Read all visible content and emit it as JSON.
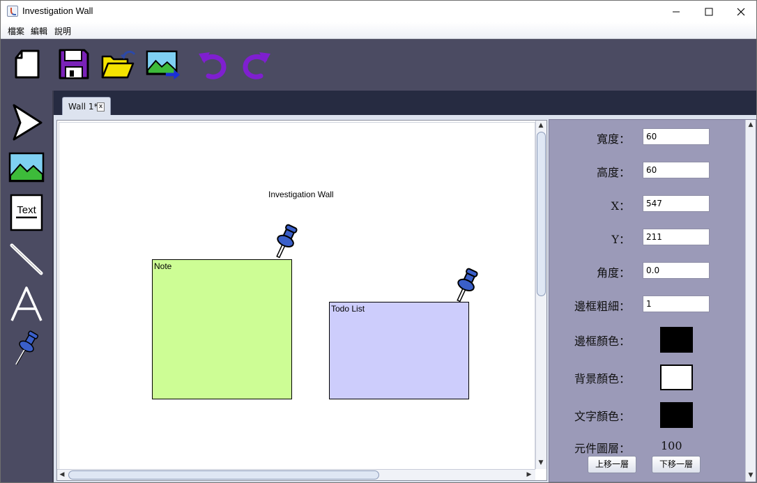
{
  "window": {
    "title": "Investigation Wall",
    "controls": {
      "minimize": "minimize",
      "maximize": "maximize",
      "close": "close"
    }
  },
  "menu": {
    "items": [
      "檔案",
      "編輯",
      "說明"
    ]
  },
  "toolbar": {
    "buttons": [
      {
        "icon": "new-file-icon"
      },
      {
        "icon": "save-icon",
        "color": "#7a22b8"
      },
      {
        "icon": "open-folder-icon",
        "color": "#f5e400"
      },
      {
        "icon": "export-image-icon"
      },
      {
        "icon": "undo-icon",
        "color": "#7f1fd0"
      },
      {
        "icon": "redo-icon",
        "color": "#7f1fd0"
      }
    ]
  },
  "sidebar": {
    "tools": [
      {
        "icon": "select-arrow-icon"
      },
      {
        "icon": "image-tool-icon"
      },
      {
        "icon": "text-tool-icon",
        "label": "Text"
      },
      {
        "icon": "line-tool-icon"
      },
      {
        "icon": "letter-a-tool-icon"
      },
      {
        "icon": "pushpin-tool-icon"
      }
    ]
  },
  "tabs": [
    {
      "label": "Wall 1*",
      "close": "x"
    }
  ],
  "canvas": {
    "title": "Investigation Wall",
    "notes": [
      {
        "label": "Note",
        "color": "#cdfd95"
      },
      {
        "label": "Todo List",
        "color": "#cdcdfc"
      }
    ],
    "pin_color": "#3a5fc9"
  },
  "properties": {
    "fields": [
      {
        "label": "寬度：",
        "value": "60"
      },
      {
        "label": "高度：",
        "value": "60"
      },
      {
        "label": "X：",
        "value": "547"
      },
      {
        "label": "Y：",
        "value": "211"
      },
      {
        "label": "角度：",
        "value": "0.0"
      },
      {
        "label": "邊框粗細：",
        "value": "1"
      }
    ],
    "colors": [
      {
        "label": "邊框顏色：",
        "color": "#000000"
      },
      {
        "label": "背景顏色：",
        "color": "#ffffff"
      },
      {
        "label": "文字顏色：",
        "color": "#000000"
      }
    ],
    "layer": {
      "label": "元件圖層：",
      "value": "100"
    },
    "buttons": {
      "up": "上移一層",
      "down": "下移一層"
    }
  }
}
